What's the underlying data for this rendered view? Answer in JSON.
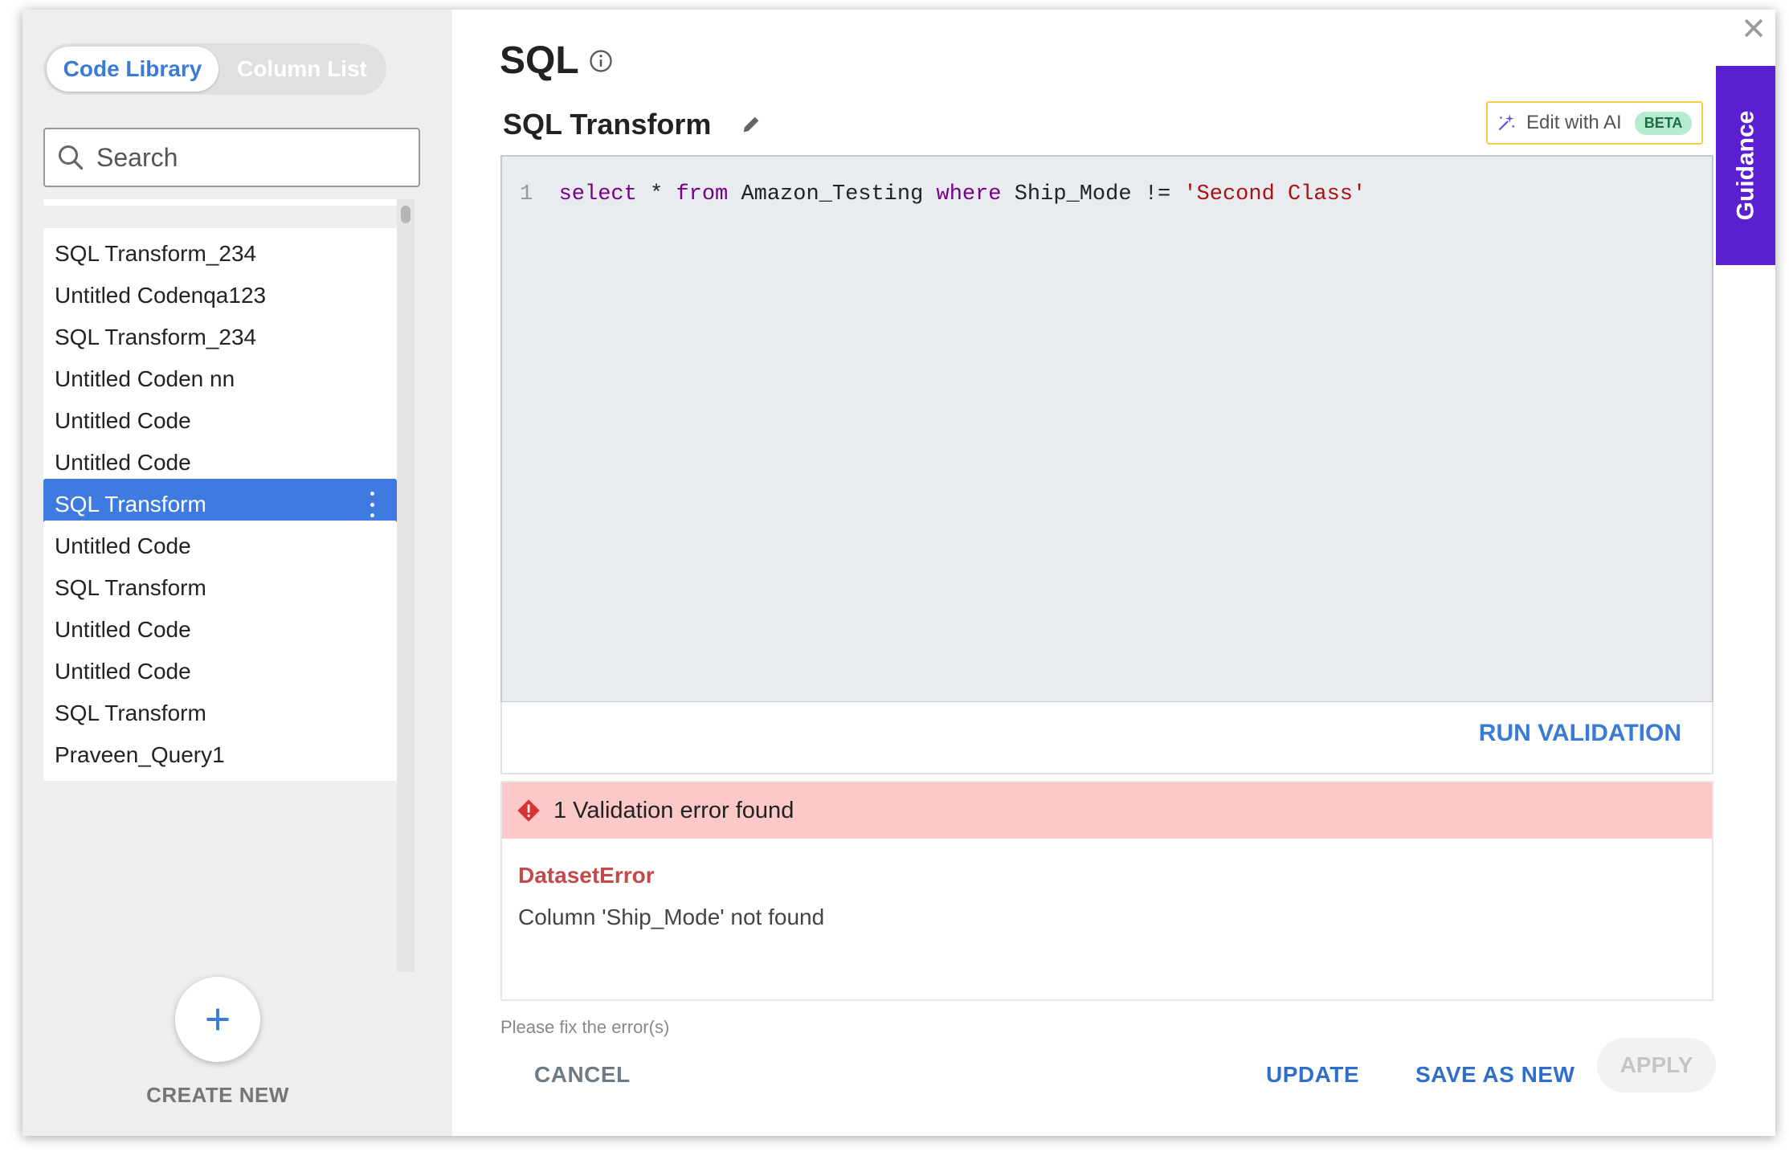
{
  "sidebar": {
    "tabs": [
      {
        "label": "Code Library",
        "active": true
      },
      {
        "label": "Column List",
        "active": false
      }
    ],
    "search": {
      "placeholder": "Search",
      "value": ""
    },
    "items": [
      {
        "label": "SQL Transform_234",
        "selected": false
      },
      {
        "label": "Untitled Codenqa123",
        "selected": false
      },
      {
        "label": "SQL Transform_234",
        "selected": false
      },
      {
        "label": "Untitled Coden nn",
        "selected": false
      },
      {
        "label": "Untitled Code",
        "selected": false
      },
      {
        "label": "Untitled Code",
        "selected": false
      },
      {
        "label": "SQL Transform",
        "selected": true
      },
      {
        "label": "Untitled Code",
        "selected": false
      },
      {
        "label": "SQL Transform",
        "selected": false
      },
      {
        "label": "Untitled Code",
        "selected": false
      },
      {
        "label": "Untitled Code",
        "selected": false
      },
      {
        "label": "SQL Transform",
        "selected": false
      },
      {
        "label": "Praveen_Query1",
        "selected": false
      }
    ],
    "create_label": "CREATE NEW"
  },
  "main": {
    "title": "SQL",
    "transform_name": "SQL Transform",
    "ai_button": {
      "label": "Edit with AI",
      "badge": "BETA"
    },
    "guidance_label": "Guidance",
    "editor": {
      "line_number": "1",
      "tokens": [
        {
          "text": "select",
          "kind": "kw"
        },
        {
          "text": " * ",
          "kind": "id"
        },
        {
          "text": "from",
          "kind": "kw"
        },
        {
          "text": " Amazon_Testing ",
          "kind": "id"
        },
        {
          "text": "where",
          "kind": "kw"
        },
        {
          "text": " Ship_Mode != ",
          "kind": "id"
        },
        {
          "text": "'Second Class'",
          "kind": "str"
        }
      ]
    },
    "run_validation_label": "RUN VALIDATION",
    "validation": {
      "header": "1 Validation error found",
      "error_type": "DatasetError",
      "error_message": "Column 'Ship_Mode' not found"
    },
    "hint": "Please fix the error(s)",
    "buttons": {
      "cancel": "CANCEL",
      "update": "UPDATE",
      "save_as_new": "SAVE AS NEW",
      "apply": "APPLY"
    }
  },
  "colors": {
    "accent": "#3d7be0",
    "guidance": "#5a1fd1",
    "error_bg": "#fcc8c8",
    "error_text": "#c44a4a"
  }
}
